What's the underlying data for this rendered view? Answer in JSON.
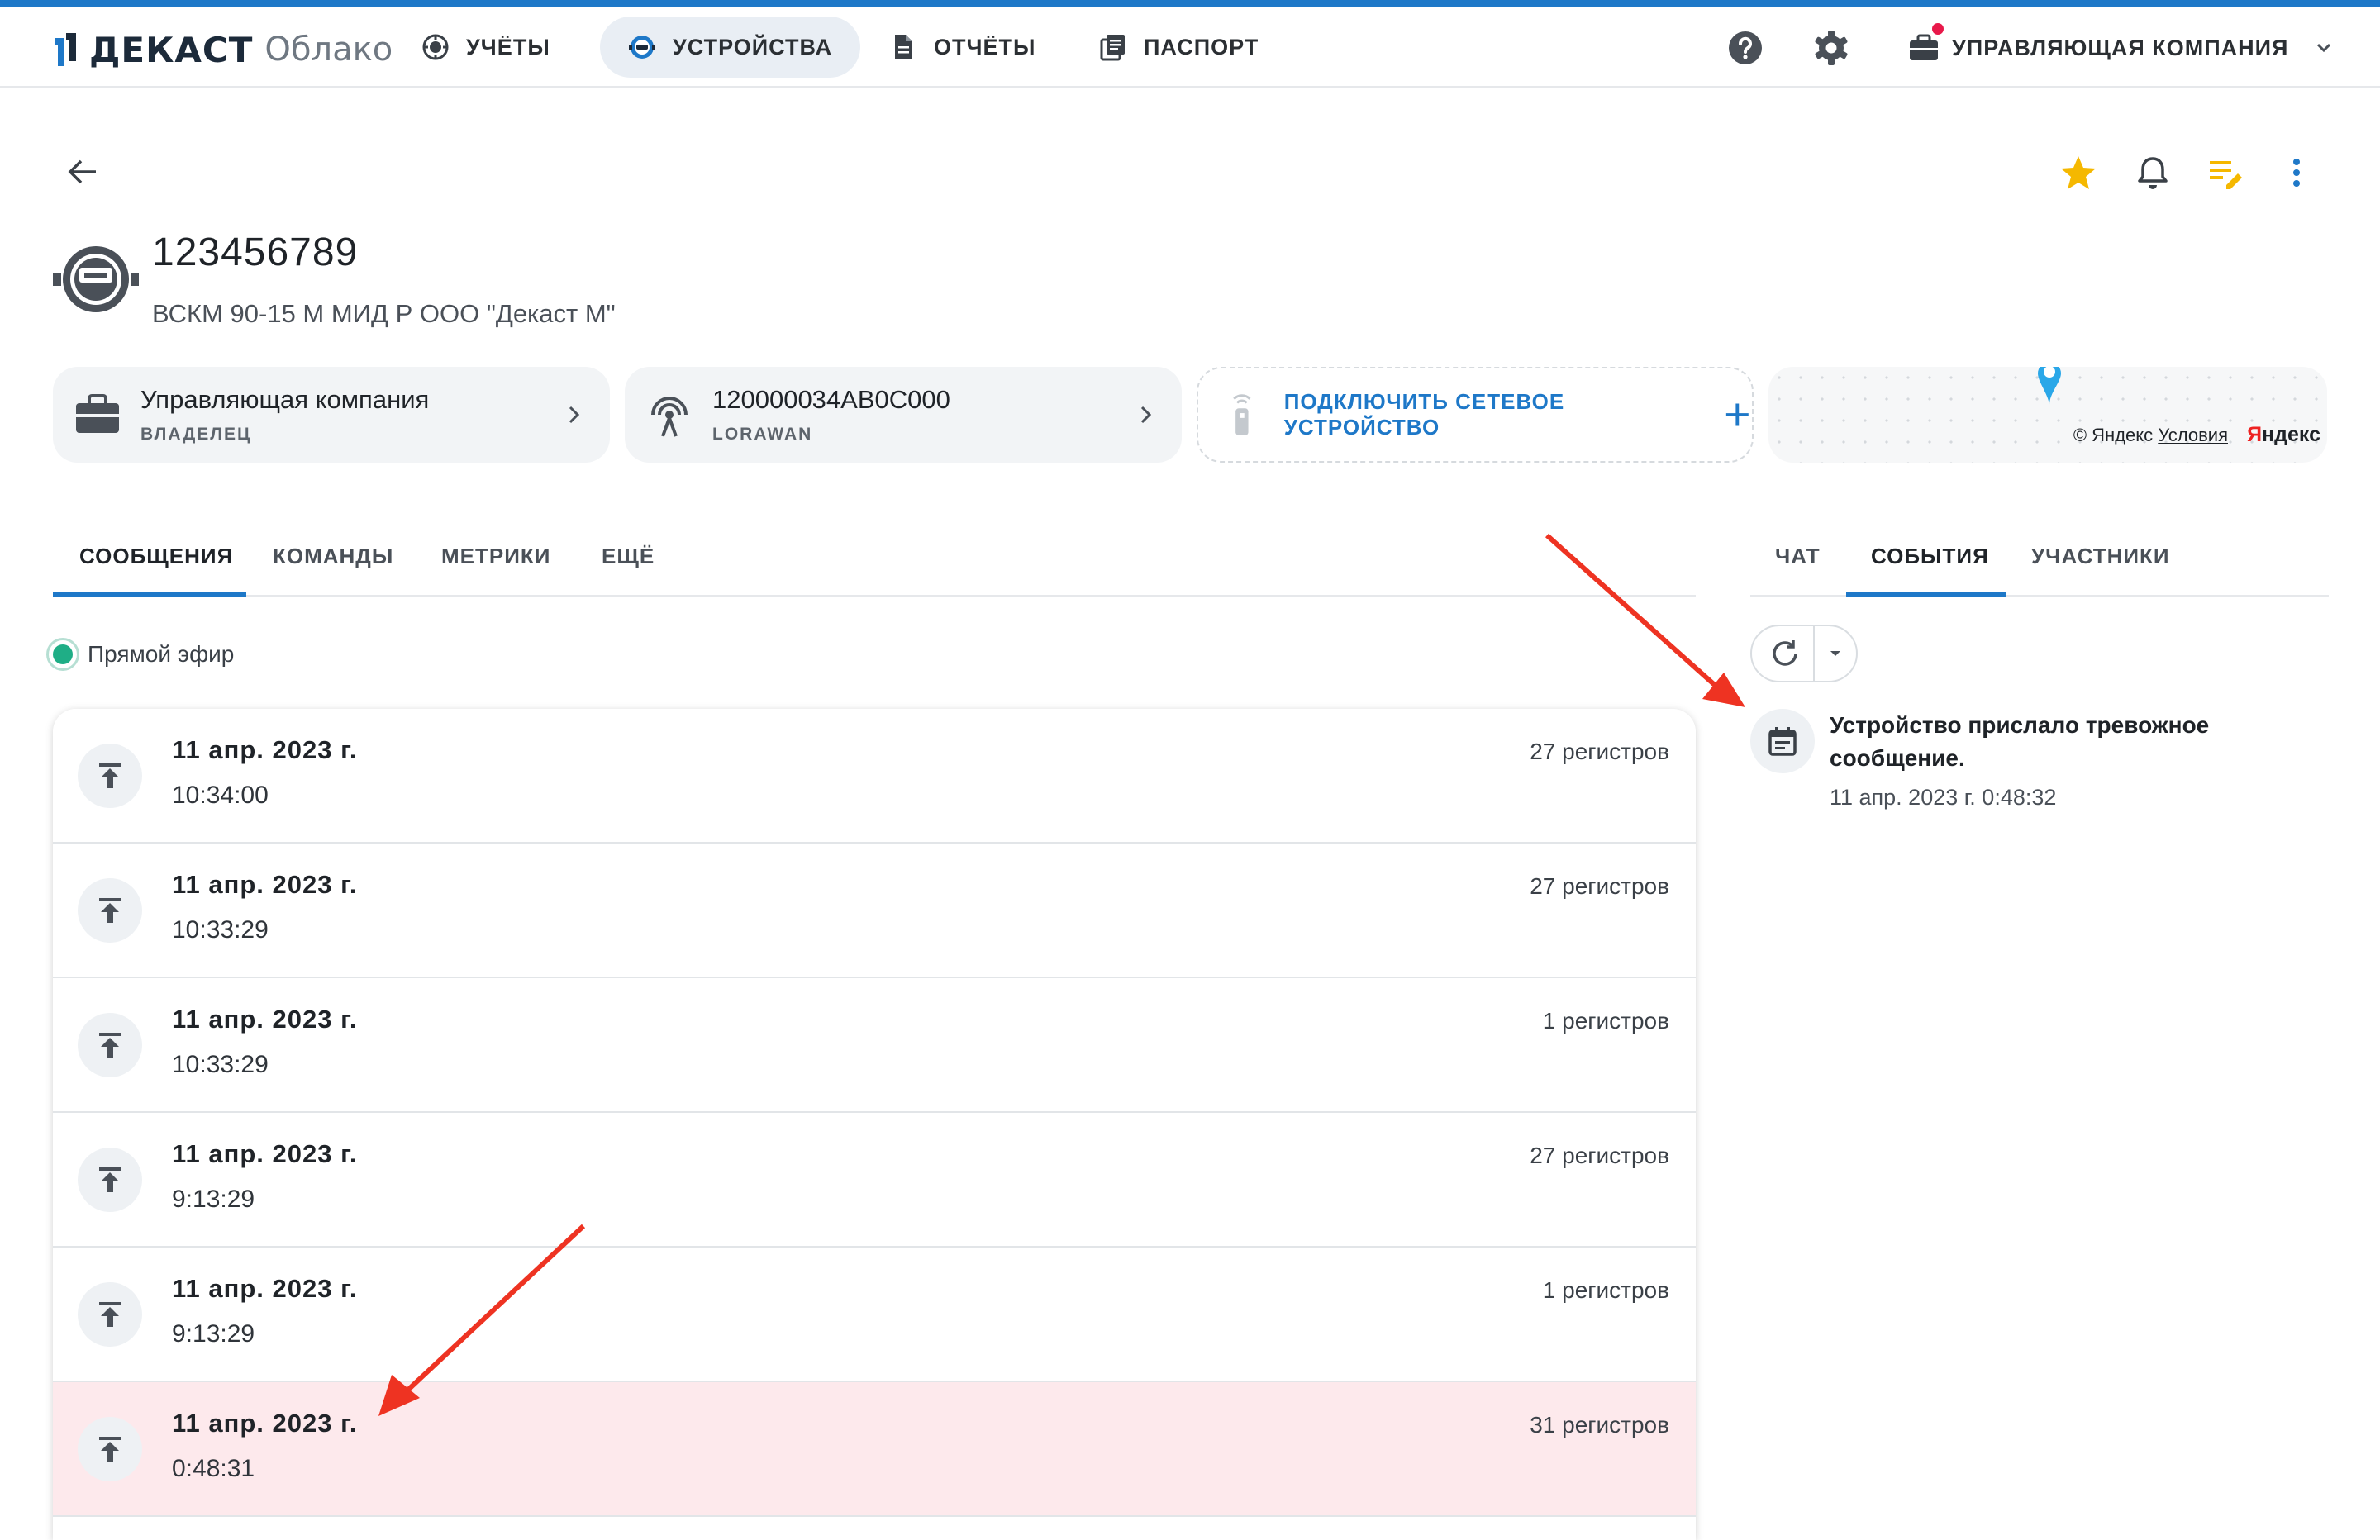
{
  "app": {
    "brand": "ДЕКАСТ",
    "brand_sub": "Облако"
  },
  "nav": {
    "items": [
      {
        "label": "УЧЁТЫ",
        "icon": "meter-icon"
      },
      {
        "label": "УСТРОЙСТВА",
        "icon": "device-icon",
        "active": true
      },
      {
        "label": "ОТЧЁТЫ",
        "icon": "document-icon"
      },
      {
        "label": "ПАСПОРТ",
        "icon": "passport-icon"
      }
    ],
    "company": "УПРАВЛЯЮЩАЯ КОМПАНИЯ"
  },
  "device": {
    "title": "123456789",
    "subtitle": "ВСКМ 90-15 М МИД Р ООО \"Декаст М\""
  },
  "cards": {
    "owner": {
      "main": "Управляющая компания",
      "sub": "ВЛАДЕЛЕЦ"
    },
    "network": {
      "main": "120000034AB0C000",
      "sub": "LORAWAN"
    },
    "connect_label": "ПОДКЛЮЧИТЬ СЕТЕВОЕ УСТРОЙСТВО"
  },
  "map": {
    "copyright": "© Яндекс",
    "terms": "Условия",
    "brand_a": "Я",
    "brand_b": "ндекс"
  },
  "left_tabs": [
    {
      "label": "СООБЩЕНИЯ",
      "active": true
    },
    {
      "label": "КОМАНДЫ"
    },
    {
      "label": "МЕТРИКИ"
    },
    {
      "label": "ЕЩЁ"
    }
  ],
  "right_tabs": [
    {
      "label": "ЧАТ"
    },
    {
      "label": "СОБЫТИЯ",
      "active": true
    },
    {
      "label": "УЧАСТНИКИ"
    }
  ],
  "live_label": "Прямой эфир",
  "messages": [
    {
      "date": "11 апр. 2023 г.",
      "time": "10:34:00",
      "count": "27 регистров"
    },
    {
      "date": "11 апр. 2023 г.",
      "time": "10:33:29",
      "count": "27 регистров"
    },
    {
      "date": "11 апр. 2023 г.",
      "time": "10:33:29",
      "count": "1 регистров"
    },
    {
      "date": "11 апр. 2023 г.",
      "time": "9:13:29",
      "count": "27 регистров"
    },
    {
      "date": "11 апр. 2023 г.",
      "time": "9:13:29",
      "count": "1 регистров"
    },
    {
      "date": "11 апр. 2023 г.",
      "time": "0:48:31",
      "count": "31 регистров",
      "alert": true
    }
  ],
  "event": {
    "title": "Устройство прислало тревожное сообщение.",
    "date": "11 апр. 2023 г. 0:48:32"
  },
  "colors": {
    "accent": "#1e78c8",
    "alert_row": "#fde9ec",
    "live": "#1fae86",
    "star": "#f5b800",
    "annotation_arrow": "#ee3322"
  }
}
